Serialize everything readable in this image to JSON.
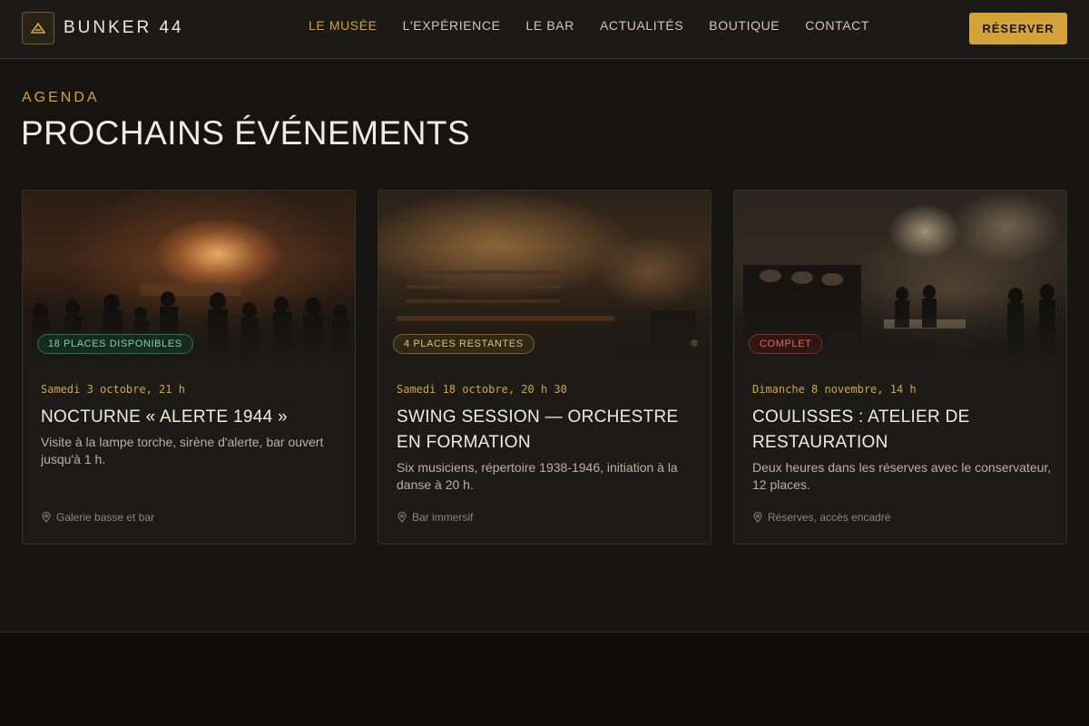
{
  "brand": {
    "name": "BUNKER 44",
    "icon": "bunker-logo-icon",
    "accent_color": "#d4a43a"
  },
  "nav": {
    "items": [
      {
        "label": "LE MUSÉE",
        "active": true
      },
      {
        "label": "L'EXPÉRIENCE",
        "active": false
      },
      {
        "label": "LE BAR",
        "active": false
      },
      {
        "label": "ACTUALITÉS",
        "active": false
      },
      {
        "label": "BOUTIQUE",
        "active": false
      },
      {
        "label": "CONTACT",
        "active": false
      }
    ],
    "cta_label": "RÉSERVER"
  },
  "section": {
    "eyebrow": "AGENDA",
    "title": "PROCHAINS ÉVÉNEMENTS"
  },
  "events": [
    {
      "badge": "18 PLACES DISPONIBLES",
      "badge_status": "available",
      "date": "Samedi 3 octobre, 21 h",
      "title": "NOCTURNE « ALERTE 1944 »",
      "description": "Visite à la lampe torche, sirène d'alerte, bar ouvert jusqu'à 1 h.",
      "location": "Galerie basse et bar",
      "location_icon": "map-pin-icon"
    },
    {
      "badge": "4 PLACES RESTANTES",
      "badge_status": "limited",
      "date": "Samedi 18 octobre, 20 h 30",
      "title": "SWING SESSION — ORCHESTRE EN FORMATION",
      "description": "Six musiciens, répertoire 1938-1946, initiation à la danse à 20 h.",
      "location": "Bar immersif",
      "location_icon": "map-pin-icon"
    },
    {
      "badge": "COMPLET",
      "badge_status": "full",
      "date": "Dimanche 8 novembre, 14 h",
      "title": "COULISSES : ATELIER DE RESTAURATION",
      "description": "Deux heures dans les réserves avec le conservateur, 12 places.",
      "location": "Réserves, accès encadré",
      "location_icon": "map-pin-icon"
    }
  ]
}
